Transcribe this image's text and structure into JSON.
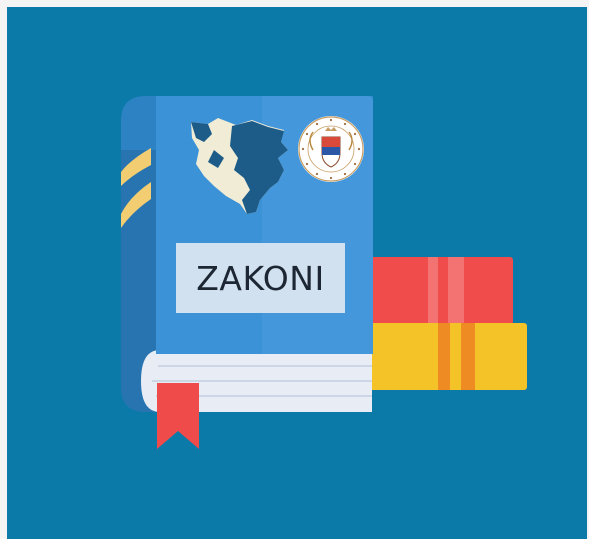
{
  "app": {
    "title_label": "ZAKONI"
  },
  "colors": {
    "background": "#0b7aa9",
    "book_cover": "#3c92d6",
    "book_spine": "#2d82c4",
    "stripes": "#f3cd71",
    "pages": "#e7ecf5",
    "bookmark": "#ef4b4b",
    "red_book": "#f04c4c",
    "yellow_book": "#f4c327",
    "map_fill": "#1d5c88",
    "map_outline": "#f1ecd6"
  },
  "icons": {
    "map": "bosnia-herzegovina-map-icon",
    "emblem": "national-assembly-emblem-icon",
    "bookmark": "bookmark-ribbon-icon"
  }
}
